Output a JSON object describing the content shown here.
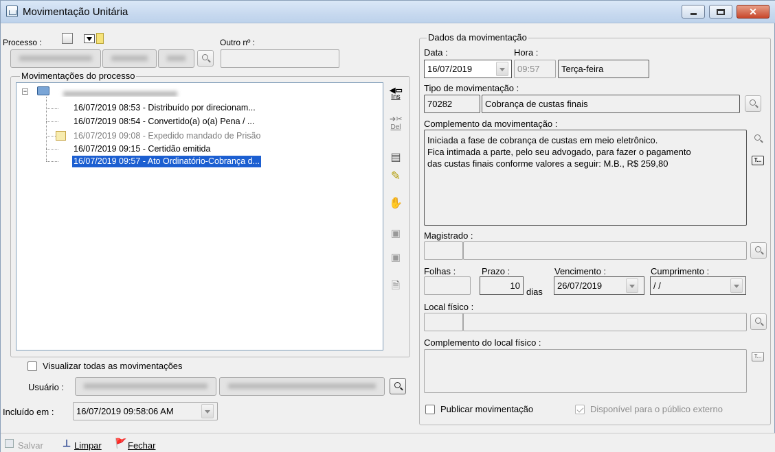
{
  "window": {
    "title": "Movimentação Unitária"
  },
  "processo": {
    "label": "Processo :",
    "outro_label": "Outro nº :"
  },
  "movimentacoes": {
    "group_title": "Movimentações do processo",
    "items": [
      {
        "text": "16/07/2019 08:53 - Distribuído por direcionam...",
        "state": "normal"
      },
      {
        "text": "16/07/2019 08:54 - Convertido(a) o(a) Pena / ...",
        "state": "normal"
      },
      {
        "text": "16/07/2019 09:08 - Expedido mandado de Prisão",
        "state": "gray"
      },
      {
        "text": "16/07/2019 09:15 - Certidão emitida",
        "state": "normal"
      },
      {
        "text": "16/07/2019 09:57 - Ato Ordinatório-Cobrança d...",
        "state": "selected"
      }
    ]
  },
  "toolbar": {
    "ins_label": "Ins",
    "del_label": "Del"
  },
  "visualizar_todas": {
    "label": "Visualizar todas as movimentações",
    "checked": false
  },
  "usuario": {
    "label": "Usuário :"
  },
  "incluido": {
    "label": "Incluído em :",
    "value": "16/07/2019 09:58:06 AM"
  },
  "dados": {
    "group_title": "Dados da movimentação",
    "data_label": "Data :",
    "data_value": "16/07/2019",
    "hora_label": "Hora :",
    "hora_value": "09:57",
    "dia_semana": "Terça-feira",
    "tipo_label": "Tipo de movimentação :",
    "tipo_code": "70282",
    "tipo_desc": "Cobrança de custas finais",
    "complemento_label": "Complemento da movimentação :",
    "complemento_lines": [
      "Iniciada a fase de cobrança de custas em meio eletrônico.",
      "Fica intimada a parte, pelo seu advogado, para fazer o pagamento",
      "das custas finais conforme valores a seguir: M.B., R$ 259,80"
    ],
    "magistrado_label": "Magistrado :",
    "folhas_label": "Folhas :",
    "prazo_label": "Prazo :",
    "prazo_value": "10",
    "prazo_unit": "dias",
    "vencimento_label": "Vencimento :",
    "vencimento_value": "26/07/2019",
    "cumprimento_label": "Cumprimento :",
    "cumprimento_value": " /  /",
    "local_label": "Local físico :",
    "complemento_local_label": "Complemento do local físico :",
    "publicar_label": "Publicar movimentação",
    "disponivel_label": "Disponível para o público externo",
    "text_button": "T..."
  },
  "bottom": {
    "salvar": "Salvar",
    "limpar": "Limpar",
    "fechar": "Fechar"
  },
  "colors": {
    "selection": "#1c5fd1",
    "close_button": "#c7472b",
    "titlebar": "#c7d9ef"
  }
}
